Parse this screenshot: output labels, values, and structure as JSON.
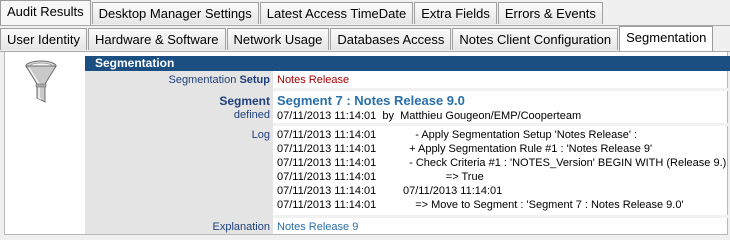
{
  "tabs_top": [
    {
      "label": "Audit Results",
      "active": true
    },
    {
      "label": "Desktop Manager Settings",
      "active": false
    },
    {
      "label": "Latest Access TimeDate",
      "active": false
    },
    {
      "label": "Extra Fields",
      "active": false
    },
    {
      "label": "Errors & Events",
      "active": false
    }
  ],
  "tabs_sub": [
    {
      "label": "User Identity",
      "active": false
    },
    {
      "label": "Hardware & Software",
      "active": false
    },
    {
      "label": "Network Usage",
      "active": false
    },
    {
      "label": "Databases Access",
      "active": false
    },
    {
      "label": "Notes Client Configuration",
      "active": false
    },
    {
      "label": "Segmentation",
      "active": true
    }
  ],
  "panel": {
    "title": "Segmentation",
    "setup_label_prefix": "Segmentation",
    "setup_label_bold": "Setup",
    "setup_value": "Notes Release",
    "segment_label": "Segment",
    "segment_value": "Segment 7 : Notes Release 9.0",
    "defined_label": "defined",
    "defined_value": "07/11/2013 11:14:01  by  Matthieu Gougeon/EMP/Cooperteam",
    "log_label": "Log",
    "log": [
      {
        "ts": "07/11/2013 11:14:01",
        "msg": "    - Apply Segmentation Setup 'Notes Release' :"
      },
      {
        "ts": "07/11/2013 11:14:01",
        "msg": "  + Apply Segmentation Rule #1 : 'Notes Release 9'"
      },
      {
        "ts": "07/11/2013 11:14:01",
        "msg": "  - Check Criteria #1 : 'NOTES_Version' BEGIN WITH (Release 9.)"
      },
      {
        "ts": "07/11/2013 11:14:01",
        "msg": "              => True"
      },
      {
        "ts": "07/11/2013 11:14:01",
        "msg": "07/11/2013 11:14:01"
      },
      {
        "ts": "07/11/2013 11:14:01",
        "msg": "    => Move to Segment : 'Segment 7 : Notes Release 9.0'"
      }
    ],
    "explanation_label": "Explanation",
    "explanation_value": "Notes Release 9"
  },
  "icon": "filter-funnel-icon",
  "colors": {
    "header": "#1b4f82",
    "label": "#1f3f7a",
    "red": "#a50000",
    "blue": "#2a6fa8"
  }
}
